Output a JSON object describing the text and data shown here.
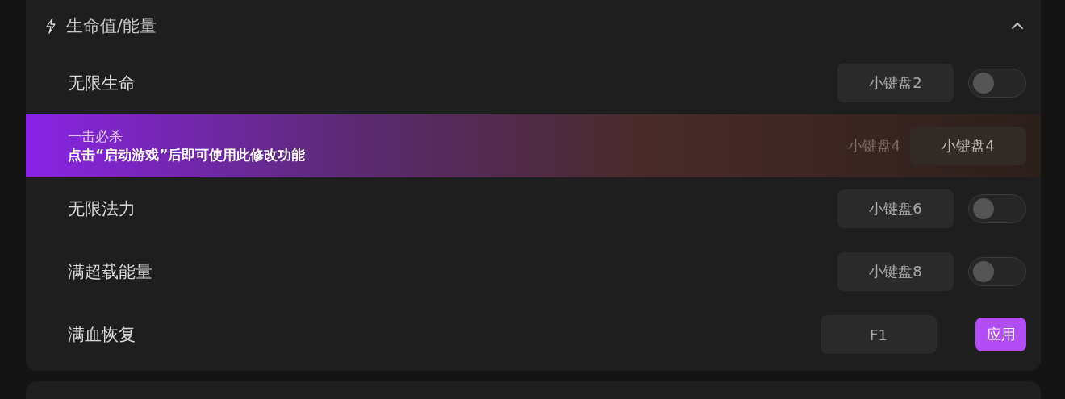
{
  "section": {
    "title": "生命值/能量",
    "expanded": true,
    "rows": [
      {
        "kind": "toggle",
        "name": "无限生命",
        "hotkey": "小键盘2",
        "on": false
      },
      {
        "kind": "locked",
        "name": "一击必杀",
        "message": "点击“启动游戏”后即可使用此修改功能",
        "ghost_hotkey": "小键盘4",
        "hotkey": "小键盘4"
      },
      {
        "kind": "toggle",
        "name": "无限法力",
        "hotkey": "小键盘6",
        "on": false
      },
      {
        "kind": "toggle",
        "name": "满超载能量",
        "hotkey": "小键盘8",
        "on": false
      },
      {
        "kind": "apply",
        "name": "满血恢复",
        "hotkey": "F1",
        "button": "应用"
      }
    ]
  }
}
